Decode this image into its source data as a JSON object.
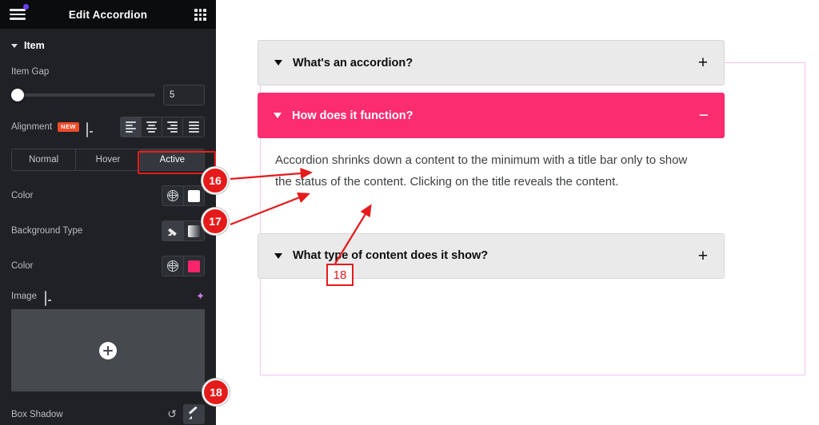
{
  "panel": {
    "title": "Edit Accordion",
    "menu_icon": "hamburger-icon",
    "grid_icon": "apps-grid-icon",
    "section": {
      "label": "Item"
    },
    "item_gap": {
      "label": "Item Gap",
      "value": "5"
    },
    "alignment": {
      "label": "Alignment",
      "badge": "NEW",
      "device_icon": "monitor-icon",
      "options": [
        "align-left",
        "align-center",
        "align-right",
        "align-justify"
      ],
      "selected": "align-left"
    },
    "state_tabs": {
      "items": [
        "Normal",
        "Hover",
        "Active"
      ],
      "selected": "Active"
    },
    "color_normal": {
      "label": "Color",
      "globe_icon": "globe-icon",
      "swatch": "#ffffff"
    },
    "background_type": {
      "label": "Background Type",
      "brush_icon": "brush-icon",
      "gradient_icon": "gradient-icon",
      "selected": "classic"
    },
    "color_background": {
      "label": "Color",
      "globe_icon": "globe-icon",
      "swatch": "#f8246c"
    },
    "image": {
      "label": "Image",
      "device_icon": "monitor-icon",
      "ai_icon": "sparkle-icon",
      "add_icon": "plus-circle-icon"
    },
    "box_shadow": {
      "label": "Box Shadow",
      "reset_icon": "reset-icon",
      "edit_icon": "pencil-icon"
    },
    "collapse_handle": {
      "icon": "chevron-left-icon"
    }
  },
  "canvas": {
    "frame_border_color": "#f0c6ef",
    "accordion": {
      "items": [
        {
          "title": "What's an accordion?",
          "state": "normal",
          "sign": "+",
          "caret": "caret-down-icon",
          "body": ""
        },
        {
          "title": "How does it function?",
          "state": "active",
          "sign": "−",
          "caret": "caret-down-icon",
          "body": "Accordion shrinks down a content to the minimum with a title bar only to show the status of the content. Clicking on the title reveals the content."
        },
        {
          "title": "What type of content does it show?",
          "state": "normal",
          "sign": "+",
          "caret": "caret-down-icon",
          "body": ""
        }
      ]
    }
  },
  "annotations": {
    "badges": [
      {
        "id": "16",
        "label": "16"
      },
      {
        "id": "17",
        "label": "17"
      },
      {
        "id": "18-panel",
        "label": "18"
      }
    ],
    "boxes": [
      {
        "id": "18-canvas",
        "label": "18"
      }
    ],
    "highlight_color": "#e51b1b"
  }
}
